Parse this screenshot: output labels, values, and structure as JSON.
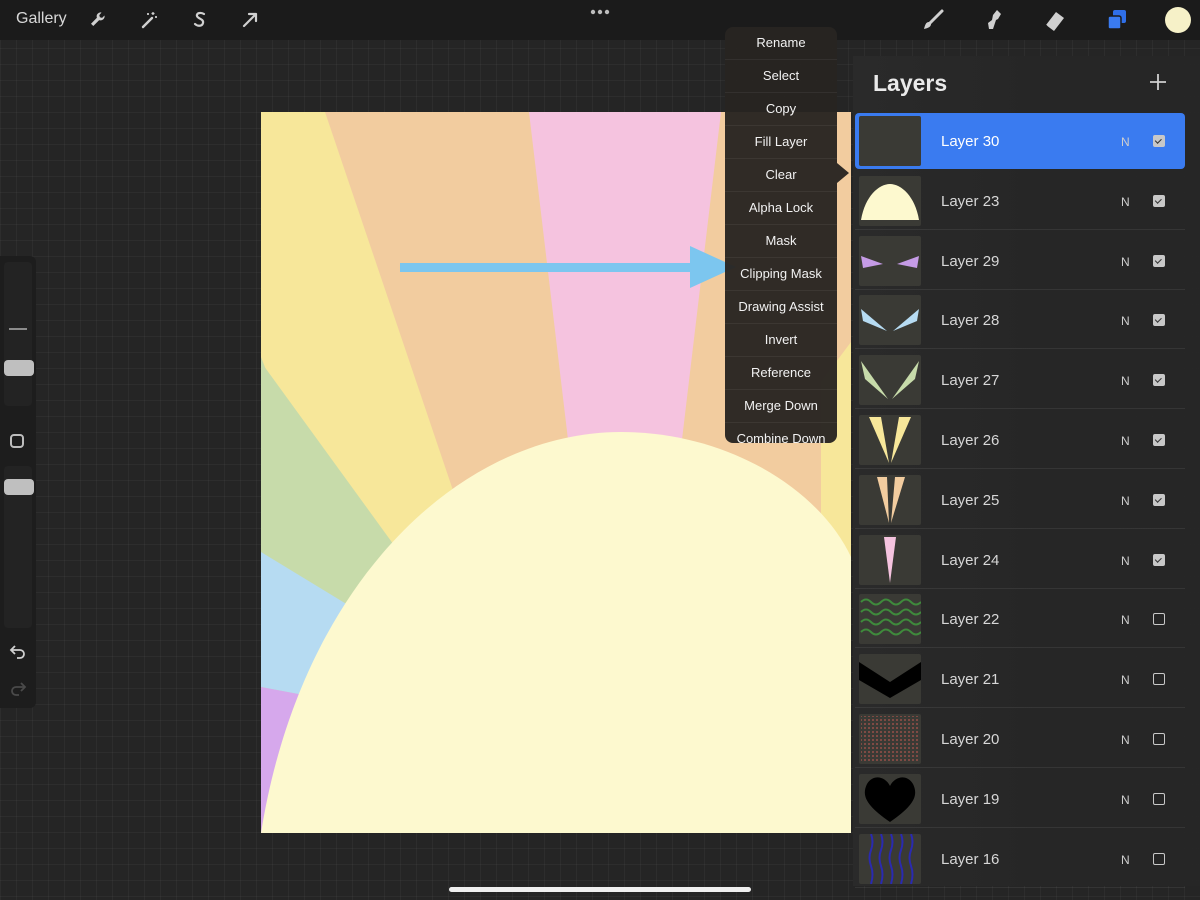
{
  "topbar": {
    "gallery_label": "Gallery",
    "left_tools": [
      "wrench-icon",
      "magic-wand-icon",
      "selection-s-icon",
      "move-arrow-icon"
    ],
    "right_tools": [
      "brush-icon",
      "smudge-icon",
      "eraser-icon",
      "layers-icon"
    ],
    "current_color": "#f6f1c8"
  },
  "context_menu": {
    "items": [
      "Rename",
      "Select",
      "Copy",
      "Fill Layer",
      "Clear",
      "Alpha Lock",
      "Mask",
      "Clipping Mask",
      "Drawing Assist",
      "Invert",
      "Reference",
      "Merge Down",
      "Combine Down"
    ]
  },
  "layers": {
    "title": "Layers",
    "items": [
      {
        "name": "Layer 30",
        "blend": "N",
        "visible": true,
        "active": true,
        "thumb": "blank"
      },
      {
        "name": "Layer 23",
        "blend": "N",
        "visible": true,
        "active": false,
        "thumb": "sun"
      },
      {
        "name": "Layer 29",
        "blend": "N",
        "visible": true,
        "active": false,
        "thumb": "purple-rays"
      },
      {
        "name": "Layer 28",
        "blend": "N",
        "visible": true,
        "active": false,
        "thumb": "blue-rays"
      },
      {
        "name": "Layer 27",
        "blend": "N",
        "visible": true,
        "active": false,
        "thumb": "green-rays"
      },
      {
        "name": "Layer 26",
        "blend": "N",
        "visible": true,
        "active": false,
        "thumb": "yellow-rays"
      },
      {
        "name": "Layer 25",
        "blend": "N",
        "visible": true,
        "active": false,
        "thumb": "orange-rays"
      },
      {
        "name": "Layer 24",
        "blend": "N",
        "visible": true,
        "active": false,
        "thumb": "pink-ray"
      },
      {
        "name": "Layer 22",
        "blend": "N",
        "visible": false,
        "active": false,
        "thumb": "green-waves"
      },
      {
        "name": "Layer 21",
        "blend": "N",
        "visible": false,
        "active": false,
        "thumb": "black-chevron"
      },
      {
        "name": "Layer 20",
        "blend": "N",
        "visible": false,
        "active": false,
        "thumb": "red-dots"
      },
      {
        "name": "Layer 19",
        "blend": "N",
        "visible": false,
        "active": false,
        "thumb": "black-heart"
      },
      {
        "name": "Layer 16",
        "blend": "N",
        "visible": false,
        "active": false,
        "thumb": "blue-lines"
      }
    ]
  },
  "colors": {
    "accent": "#3a7bf0",
    "arrow": "#7cc6ef",
    "sun": "#fdf9cf",
    "ray_yellow": "#f7e79a",
    "ray_orange": "#f2cc9f",
    "ray_pink": "#f5c3df",
    "ray_green": "#c7dbaa",
    "ray_blue": "#b6dbf2",
    "ray_purple": "#d6a8ec"
  }
}
